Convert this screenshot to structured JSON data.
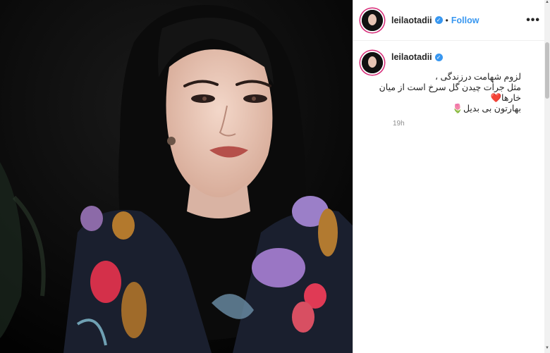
{
  "post": {
    "username": "leilaotadii",
    "follow_label": "Follow",
    "more_label": "•••",
    "verified_label": "✓",
    "separator": "•"
  },
  "comment": {
    "username": "leilaotadii",
    "caption_lines": [
      "لزوم شهامت درزندگی ،",
      "مثل جرأت چیدن گل سرخ است از میان",
      "خارها❤️",
      "بهارتون بی بدیل🌷"
    ],
    "time": "19h"
  },
  "colors": {
    "accent": "#3897f0",
    "ring": "#d62976"
  }
}
